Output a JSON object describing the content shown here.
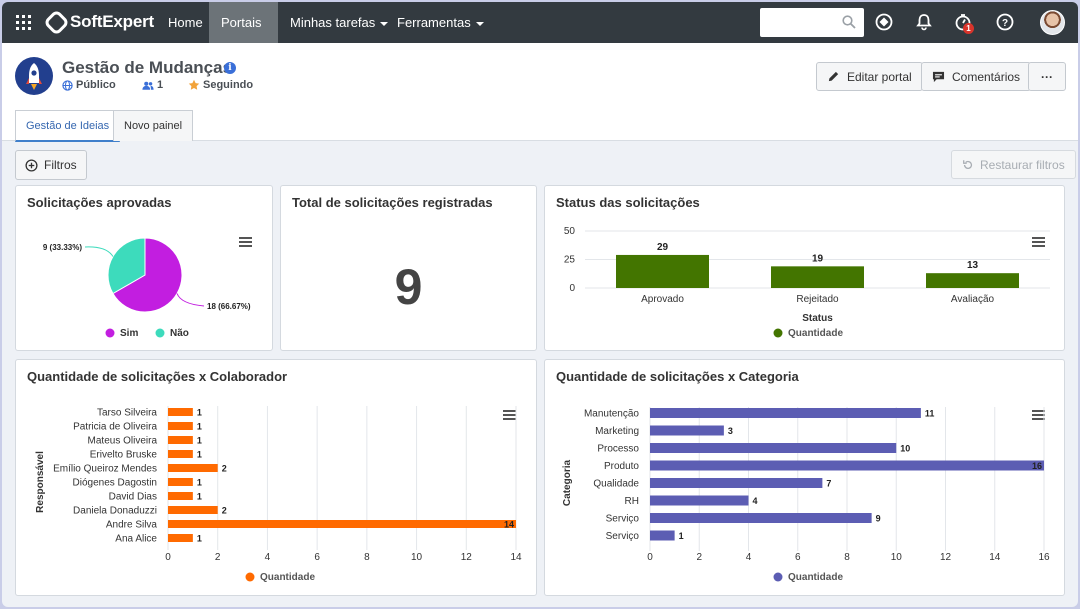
{
  "nav": {
    "brand": "SoftExpert",
    "items": [
      {
        "label": "Home"
      },
      {
        "label": "Portais"
      },
      {
        "label": "Minhas tarefas"
      },
      {
        "label": "Ferramentas"
      }
    ],
    "search_placeholder": "",
    "notification_count": "1"
  },
  "portal": {
    "title": "Gestão de Mudanças",
    "visibility": "Público",
    "members": "1",
    "follow": "Seguindo",
    "edit_button": "Editar portal",
    "comments_button": "Comentários",
    "more_button": "···"
  },
  "tabs": [
    {
      "label": "Gestão de Ideias",
      "active": true
    },
    {
      "label": "Novo painel",
      "active": false
    }
  ],
  "toolbar": {
    "filters": "Filtros",
    "restore": "Restaurar filtros"
  },
  "cards": {
    "approved": {
      "title": "Solicitações aprovadas"
    },
    "total": {
      "title": "Total de solicitações registradas",
      "value": "9"
    },
    "status": {
      "title": "Status das solicitações"
    },
    "collab": {
      "title": "Quantidade de solicitações x Colaborador"
    },
    "category": {
      "title": "Quantidade de solicitações x Categoria"
    }
  },
  "chart_data": [
    {
      "type": "pie",
      "title": "Solicitações aprovadas",
      "slices": [
        {
          "label": "Sim",
          "value": 18,
          "text": "18 (66.67%)",
          "color": "#c21ee0"
        },
        {
          "label": "Não",
          "value": 9,
          "text": "9 (33.33%)",
          "color": "#3ddbbc"
        }
      ],
      "legend": "bottom"
    },
    {
      "type": "bar",
      "title": "Status das solicitações",
      "categories": [
        "Aprovado",
        "Rejeitado",
        "Avaliação"
      ],
      "series": [
        {
          "name": "Quantidade",
          "values": [
            29,
            19,
            13
          ],
          "color": "#437500"
        }
      ],
      "xlabel": "Status",
      "ylabel": "",
      "ylim": [
        0,
        50
      ],
      "yticks": [
        0,
        25,
        50
      ],
      "legend": "bottom"
    },
    {
      "type": "bar",
      "orientation": "horizontal",
      "title": "Quantidade de solicitações x Colaborador",
      "categories": [
        "Tarso Silveira",
        "Patricia de Oliveira",
        "Mateus Oliveira",
        "Erivelto Bruske",
        "Emílio Queiroz Mendes",
        "Diógenes Dagostin",
        "David Dias",
        "Daniela Donaduzzi",
        "Andre Silva",
        "Ana Alice"
      ],
      "series": [
        {
          "name": "Quantidade",
          "values": [
            1,
            1,
            1,
            1,
            2,
            1,
            1,
            2,
            14,
            1
          ],
          "color": "#ff6a00"
        }
      ],
      "ylabel": "Responsável",
      "xlim": [
        0,
        14
      ],
      "xticks": [
        0,
        2,
        4,
        6,
        8,
        10,
        12,
        14
      ],
      "legend": "bottom"
    },
    {
      "type": "bar",
      "orientation": "horizontal",
      "title": "Quantidade de solicitações x Categoria",
      "categories": [
        "Manutenção",
        "Marketing",
        "Processo",
        "Produto",
        "Qualidade",
        "RH",
        "Serviço",
        "Serviço"
      ],
      "series": [
        {
          "name": "Quantidade",
          "values": [
            11,
            3,
            10,
            16,
            7,
            4,
            9,
            1
          ],
          "color": "#5c5db3"
        }
      ],
      "ylabel": "Categoria",
      "xlim": [
        0,
        16
      ],
      "xticks": [
        0,
        2,
        4,
        6,
        8,
        10,
        12,
        14,
        16
      ],
      "legend": "bottom"
    }
  ]
}
